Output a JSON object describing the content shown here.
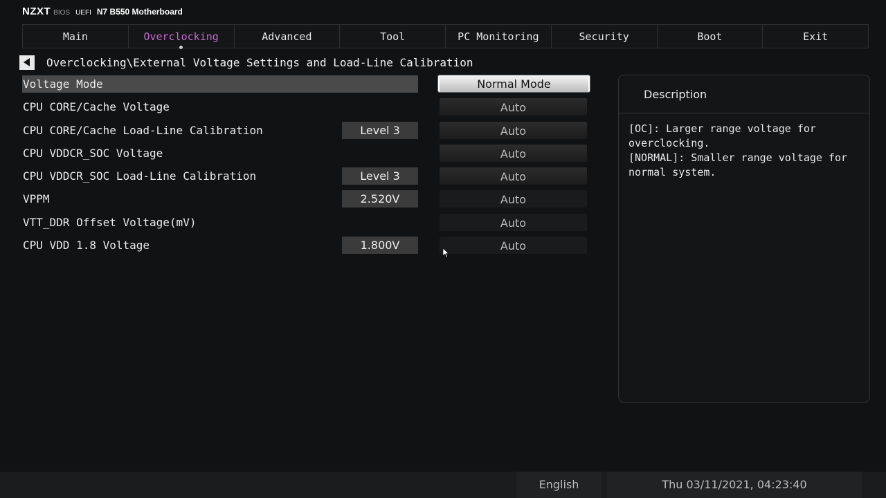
{
  "header": {
    "brand": "NZXT",
    "bios_label": "BIOS",
    "uefi_label": "UEFI",
    "model": "N7 B550 Motherboard"
  },
  "tabs": [
    {
      "label": "Main",
      "active": false
    },
    {
      "label": "Overclocking",
      "active": true
    },
    {
      "label": "Advanced",
      "active": false
    },
    {
      "label": "Tool",
      "active": false
    },
    {
      "label": "PC Monitoring",
      "active": false
    },
    {
      "label": "Security",
      "active": false
    },
    {
      "label": "Boot",
      "active": false
    },
    {
      "label": "Exit",
      "active": false
    }
  ],
  "breadcrumb": "Overclocking\\External Voltage Settings and Load-Line Calibration",
  "settings": [
    {
      "label": "Voltage Mode",
      "sub": "",
      "value": "Normal Mode",
      "selected": true
    },
    {
      "label": "CPU CORE/Cache Voltage",
      "sub": "",
      "value": "Auto"
    },
    {
      "label": "CPU CORE/Cache Load-Line Calibration",
      "sub": "Level 3",
      "value": "Auto"
    },
    {
      "label": "CPU VDDCR_SOC Voltage",
      "sub": "",
      "value": "Auto"
    },
    {
      "label": "CPU VDDCR_SOC Load-Line Calibration",
      "sub": "Level 3",
      "value": "Auto"
    },
    {
      "label": "VPPM",
      "sub": "2.520V",
      "value": "Auto"
    },
    {
      "label": "VTT_DDR Offset Voltage(mV)",
      "sub": "",
      "value": "Auto"
    },
    {
      "label": "CPU VDD 1.8 Voltage",
      "sub": "1.800V",
      "value": "Auto"
    }
  ],
  "description": {
    "title": "Description",
    "body": "[OC]: Larger range voltage for\noverclocking.\n[NORMAL]: Smaller range voltage for\nnormal system."
  },
  "footer": {
    "language": "English",
    "datetime": "Thu 03/11/2021, 04:23:40"
  },
  "colors": {
    "accent": "#c86ad2",
    "background": "#111213"
  },
  "icons": {
    "back": "left-triangle-icon",
    "cursor": "mouse-pointer-icon"
  }
}
